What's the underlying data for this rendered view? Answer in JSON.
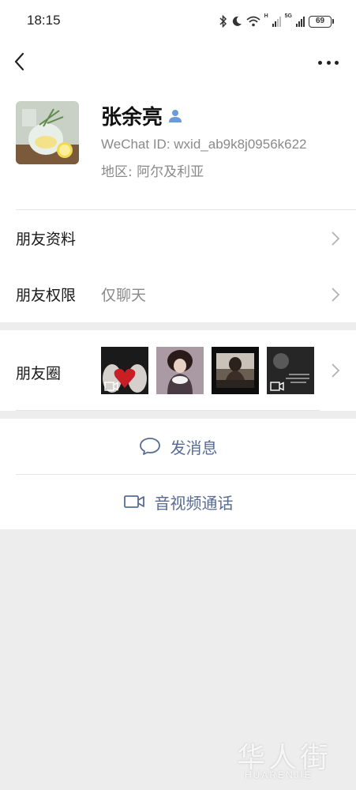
{
  "status_bar": {
    "time": "18:15",
    "network_h": "H",
    "network_5g": "5G",
    "battery": "69"
  },
  "nav": {
    "back_icon": "chevron-left-icon",
    "more_icon": "more-dots-icon"
  },
  "profile": {
    "name": "张余亮",
    "wechat_id": "WeChat ID:  wxid_ab9k8j0956k622",
    "region": "地区:  阿尔及利亚",
    "gender_icon": "male-user-icon",
    "gender_color": "#6a9bd8"
  },
  "rows": [
    {
      "title": "朋友资料",
      "value": ""
    },
    {
      "title": "朋友权限",
      "value": "仅聊天"
    }
  ],
  "moments": {
    "title": "朋友圈",
    "thumbnails": [
      {
        "subject": "heart-in-hands",
        "video": true
      },
      {
        "subject": "woman-with-bowl",
        "video": false
      },
      {
        "subject": "person-sitting",
        "video": false
      },
      {
        "subject": "dark-scene",
        "video": true
      }
    ]
  },
  "actions": {
    "message_label": "发消息",
    "call_label": "音视频通话"
  },
  "watermark": {
    "chars": "华人街",
    "latin": "HUARENJIE"
  },
  "colors": {
    "link_blue": "#576b95",
    "secondary_text": "#8a8a8a",
    "page_bg": "#ededed"
  }
}
